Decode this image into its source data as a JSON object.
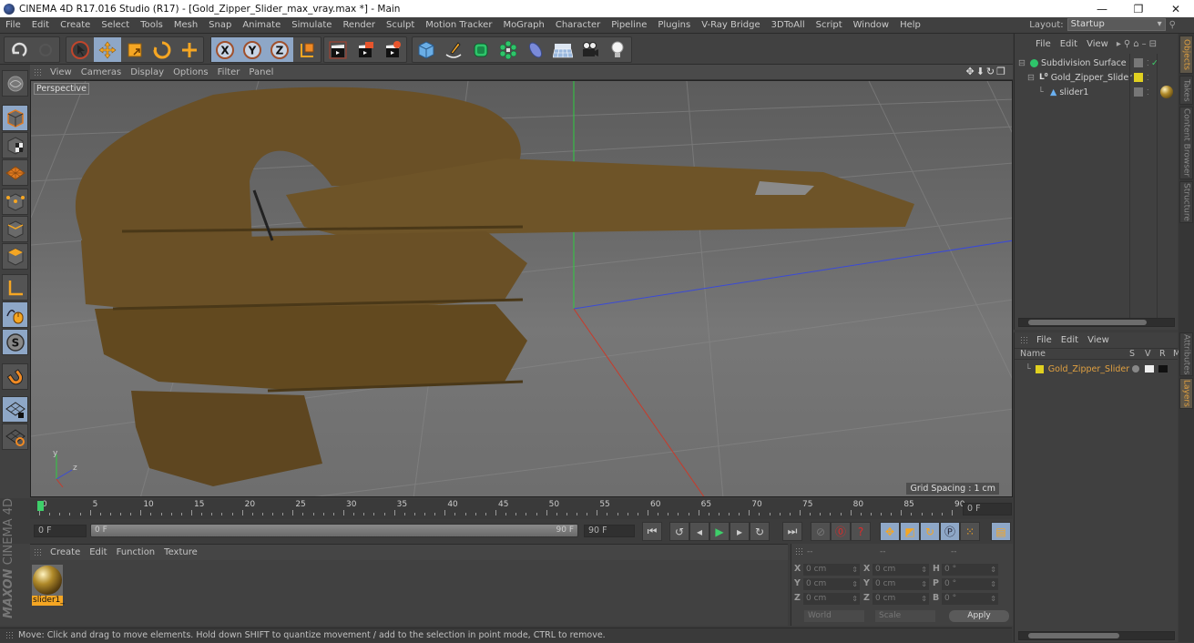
{
  "window": {
    "title": "CINEMA 4D R17.016 Studio (R17) - [Gold_Zipper_Slider_max_vray.max *] - Main",
    "controls": [
      "minimize",
      "restore",
      "close"
    ]
  },
  "menubar": {
    "items": [
      "File",
      "Edit",
      "Create",
      "Select",
      "Tools",
      "Mesh",
      "Snap",
      "Animate",
      "Simulate",
      "Render",
      "Sculpt",
      "Motion Tracker",
      "MoGraph",
      "Character",
      "Pipeline",
      "Plugins",
      "V-Ray Bridge",
      "3DToAll",
      "Script",
      "Window",
      "Help"
    ],
    "layout_label": "Layout:",
    "layout_value": "Startup"
  },
  "toolbar": {
    "groups": [
      {
        "name": "history",
        "tools": [
          "undo",
          "redo"
        ]
      },
      {
        "name": "modes",
        "tools": [
          "live-selection",
          "move",
          "scale",
          "rotate",
          "last-tool"
        ]
      },
      {
        "name": "axes",
        "tools": [
          "x-axis-lock",
          "y-axis-lock",
          "z-axis-lock",
          "coordinate-system"
        ]
      },
      {
        "name": "render",
        "tools": [
          "render-view",
          "render-picture-viewer",
          "render-settings"
        ]
      },
      {
        "name": "create",
        "tools": [
          "cube",
          "pen-spline",
          "subdivision-surface",
          "array",
          "deformer",
          "floor",
          "camera",
          "light"
        ]
      }
    ]
  },
  "left_tools": [
    "make-editable",
    "model-mode",
    "texture-mode",
    "workplane-mode",
    "points-mode",
    "edges-mode",
    "polygons-mode",
    "axis-mode",
    "tweak-mode",
    "soft-selection",
    "snapping",
    "workplane-lock",
    "workplane-grid"
  ],
  "viewport": {
    "menu": [
      "View",
      "Cameras",
      "Display",
      "Options",
      "Filter",
      "Panel"
    ],
    "label": "Perspective",
    "grid_spacing": "Grid Spacing : 1 cm",
    "nav_icons": [
      "move-view",
      "zoom-view",
      "rotate-view",
      "maximize-view"
    ],
    "axis_labels": [
      "y",
      "z"
    ],
    "model_color": "#6f5528"
  },
  "timeline": {
    "ticks": [
      "0",
      "5",
      "10",
      "15",
      "20",
      "25",
      "30",
      "35",
      "40",
      "45",
      "50",
      "55",
      "60",
      "65",
      "70",
      "75",
      "80",
      "85",
      "90"
    ],
    "current_frame": "0 F",
    "start_field": "0 F",
    "range_start": "0 F",
    "range_end": "90 F",
    "end_field": "90 F",
    "playhead_color": "#3ecf6a"
  },
  "transport": {
    "buttons": [
      "go-to-start",
      "previous-key",
      "previous-frame",
      "play",
      "next-frame",
      "next-key",
      "go-to-end",
      "record-off",
      "autokey",
      "keyframe-selection",
      "key-move",
      "key-scale",
      "key-rotate",
      "key-param",
      "key-pla",
      "timeline-toggle"
    ]
  },
  "materials": {
    "menu": [
      "Create",
      "Edit",
      "Function",
      "Texture"
    ],
    "items": [
      {
        "name": "slider1_",
        "selected": true
      }
    ]
  },
  "coordinates": {
    "headers": [
      "--",
      "--",
      "--"
    ],
    "rows": [
      {
        "l1": "X",
        "v1": "0 cm",
        "l2": "X",
        "v2": "0 cm",
        "l3": "H",
        "v3": "0 °"
      },
      {
        "l1": "Y",
        "v1": "0 cm",
        "l2": "Y",
        "v2": "0 cm",
        "l3": "P",
        "v3": "0 °"
      },
      {
        "l1": "Z",
        "v1": "0 cm",
        "l2": "Z",
        "v2": "0 cm",
        "l3": "B",
        "v3": "0 °"
      }
    ],
    "space": "World",
    "mode": "Scale",
    "apply": "Apply"
  },
  "object_manager": {
    "menu": [
      "File",
      "Edit",
      "View"
    ],
    "objects": [
      {
        "name": "Subdivision Surface",
        "depth": 0,
        "icon": "subdivision-icon"
      },
      {
        "name": "Gold_Zipper_Slider",
        "depth": 1,
        "icon": "null-icon"
      },
      {
        "name": "slider1",
        "depth": 2,
        "icon": "polygon-icon"
      }
    ]
  },
  "layer_manager": {
    "menu": [
      "File",
      "Edit",
      "View"
    ],
    "columns": [
      "Name",
      "S",
      "V",
      "R",
      "M"
    ],
    "layers": [
      {
        "name": "Gold_Zipper_Slider",
        "color": "#e0d020"
      }
    ]
  },
  "side_tabs": {
    "top": [
      {
        "label": "Objects",
        "active": true
      },
      {
        "label": "Takes",
        "active": false
      },
      {
        "label": "Content Browser",
        "active": false
      },
      {
        "label": "Structure",
        "active": false
      }
    ],
    "bottom": [
      {
        "label": "Attributes",
        "active": false
      },
      {
        "label": "Layers",
        "active": true
      }
    ]
  },
  "status": {
    "text": "Move: Click and drag to move elements. Hold down SHIFT to quantize movement / add to the selection in point mode, CTRL to remove."
  },
  "branding": {
    "maxon": "MAXON",
    "product": "CINEMA 4D"
  }
}
